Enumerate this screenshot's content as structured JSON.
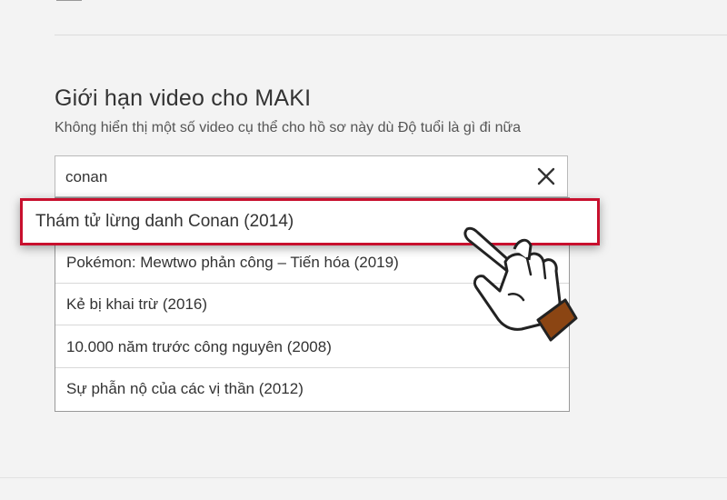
{
  "restrictions": {
    "title": "Giới hạn video cho MAKI",
    "description": "Không hiển thị một số video cụ thể cho hồ sơ này dù Độ tuổi là gì đi nữa",
    "search": {
      "value": "conan",
      "clear_icon": "close-icon"
    },
    "results": [
      {
        "label": "Thám tử lừng danh Conan (2014)",
        "highlighted": true
      },
      {
        "label": "Pokémon: Mewtwo phản công – Tiến hóa (2019)",
        "highlighted": false
      },
      {
        "label": "Kẻ bị khai trừ (2016)",
        "highlighted": false
      },
      {
        "label": "10.000 năm trước công nguyên (2008)",
        "highlighted": false
      },
      {
        "label": "Sự phẫn nộ của các vị thần (2012)",
        "highlighted": false
      }
    ]
  },
  "annotation": {
    "highlight_color": "#c8102e",
    "pointer_icon": "pointing-hand-icon",
    "cuff_color": "#8b4513"
  }
}
